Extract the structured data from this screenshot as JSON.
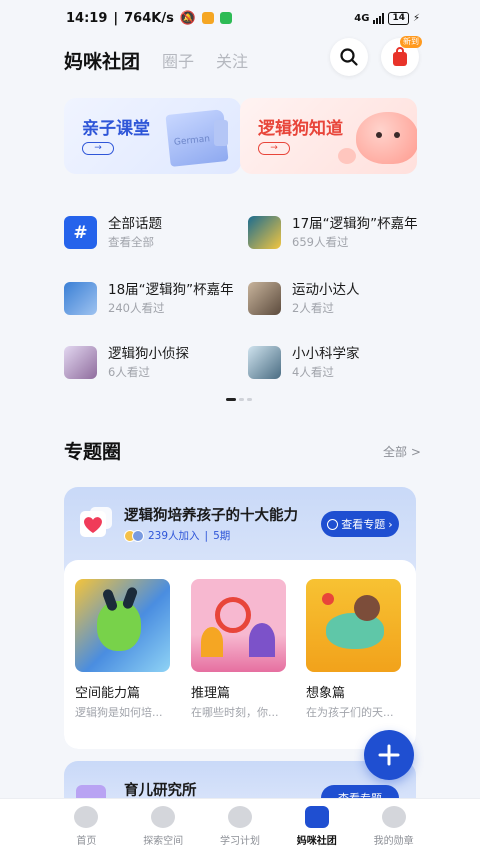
{
  "status_bar": {
    "time": "14:19",
    "network_speed": "764K/s",
    "signal": "4G",
    "battery": "14"
  },
  "header": {
    "tabs": [
      {
        "label": "妈咪社团",
        "active": true
      },
      {
        "label": "圈子",
        "active": false
      },
      {
        "label": "关注",
        "active": false
      }
    ],
    "search_icon": "search-icon",
    "cart_badge": "新到"
  },
  "banners": [
    {
      "title": "亲子课堂",
      "image_text": "German",
      "arrow": "→"
    },
    {
      "title": "逻辑狗知道",
      "arrow": "→"
    }
  ],
  "topics": [
    {
      "title": "全部话题",
      "sub": "查看全部",
      "icon": "#"
    },
    {
      "title": "17届“逻辑狗”杯嘉年",
      "sub": "659人看过"
    },
    {
      "title": "18届“逻辑狗”杯嘉年",
      "sub": "240人看过"
    },
    {
      "title": "运动小达人",
      "sub": "2人看过"
    },
    {
      "title": "逻辑狗小侦探",
      "sub": "6人看过"
    },
    {
      "title": "小小科学家",
      "sub": "4人看过"
    }
  ],
  "section": {
    "title": "专题圈",
    "more": "全部 >"
  },
  "zones": [
    {
      "title": "逻辑狗培养孩子的十大能力",
      "members": "239人加入",
      "issues": "5期",
      "button": "查看专题",
      "courses": [
        {
          "title": "空间能力篇",
          "desc": "逻辑狗是如何培..."
        },
        {
          "title": "推理篇",
          "desc": "在哪些时刻，你..."
        },
        {
          "title": "想象篇",
          "desc": "在为孩子们的天..."
        }
      ]
    },
    {
      "title": "育儿研究所",
      "button": "查看专题"
    }
  ],
  "fab": "+",
  "bottom_nav": [
    {
      "label": "首页",
      "active": false
    },
    {
      "label": "探索空间",
      "active": false
    },
    {
      "label": "学习计划",
      "active": false
    },
    {
      "label": "妈咪社团",
      "active": true
    },
    {
      "label": "我的勋章",
      "active": false
    }
  ],
  "colors": {
    "brand_blue": "#1f4fd1",
    "accent_red": "#e8453a",
    "background": "#f4f6fa"
  }
}
